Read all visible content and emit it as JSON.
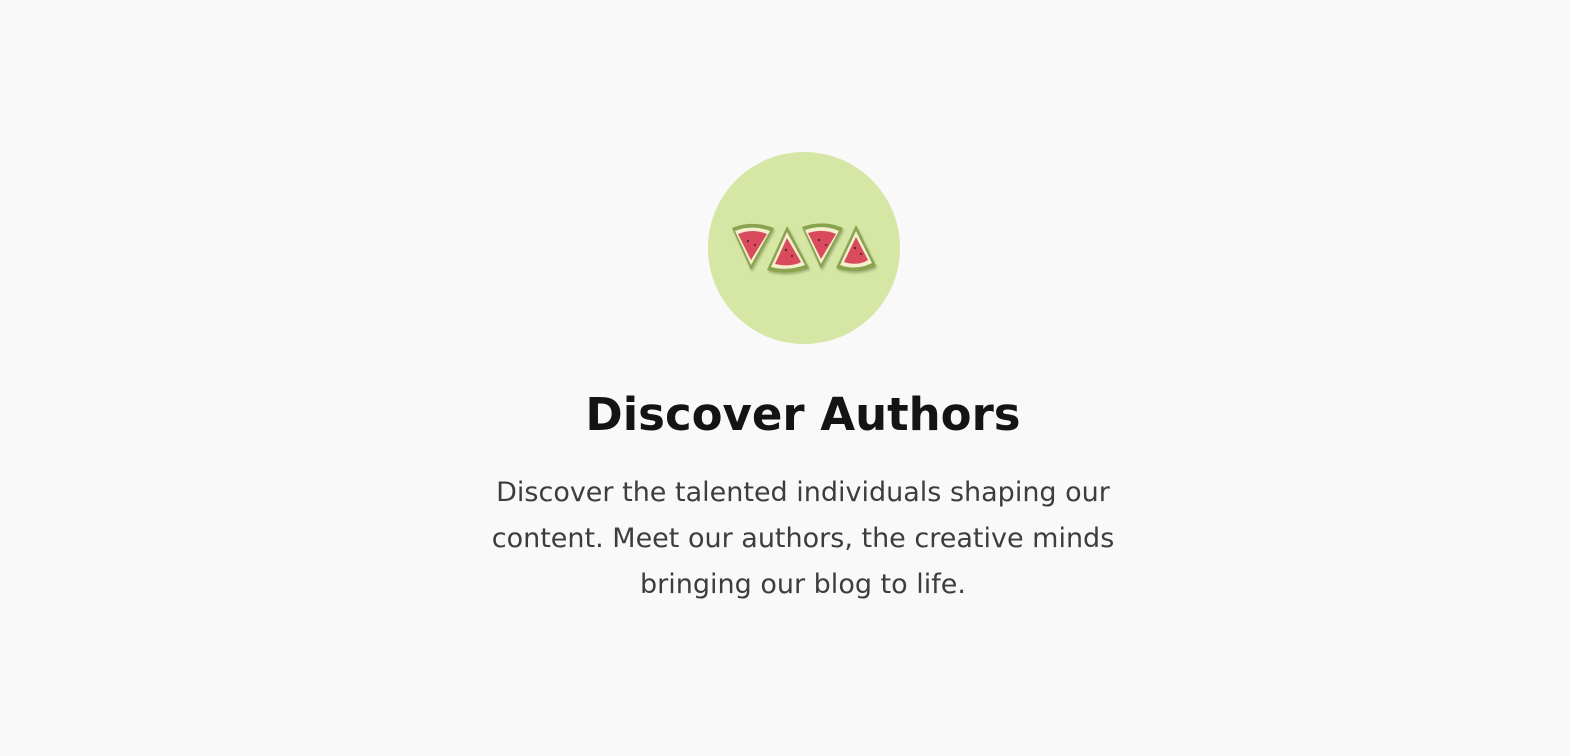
{
  "hero": {
    "title": "Discover Authors",
    "description": "Discover the talented individuals shaping our content. Meet our authors, the creative minds bringing our blog to life.",
    "image_icon": "watermelon-slices-icon"
  },
  "colors": {
    "background": "#f9f9f9",
    "avatar_background": "#d5e6a5",
    "title_text": "#141414",
    "description_text": "#3d3d3d",
    "watermelon_flesh": "#d94b5c",
    "watermelon_rind": "#8aa34f"
  }
}
